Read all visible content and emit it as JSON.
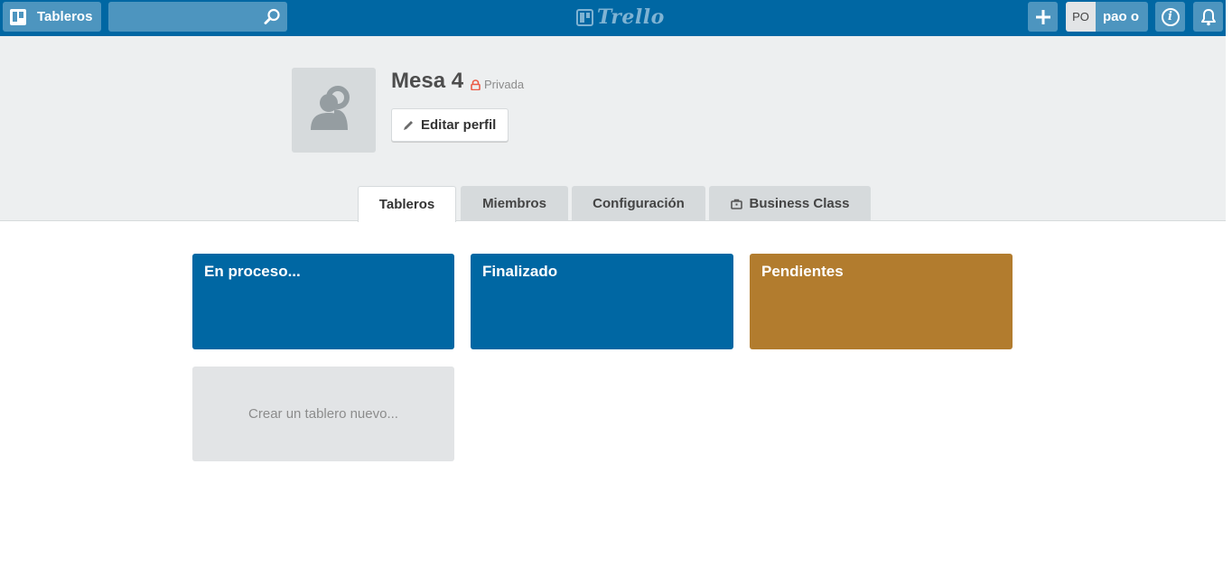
{
  "header": {
    "boards_button_label": "Tableros",
    "search": {
      "value": "",
      "placeholder": ""
    },
    "logo_text": "Trello",
    "add_icon": "plus-icon",
    "user": {
      "initials": "PO",
      "name": "pao o"
    },
    "info_icon": "info-icon",
    "notifications_icon": "bell-icon"
  },
  "profile": {
    "name": "Mesa 4",
    "privacy_label": "Privada",
    "edit_button_label": "Editar perfil"
  },
  "tabs": [
    {
      "label": "Tableros",
      "active": true
    },
    {
      "label": "Miembros",
      "active": false
    },
    {
      "label": "Configuración",
      "active": false
    },
    {
      "label": "Business Class",
      "active": false,
      "icon": "briefcase-icon"
    }
  ],
  "boards": [
    {
      "title": "En proceso...",
      "color": "#0067a3"
    },
    {
      "title": "Finalizado",
      "color": "#0067a3"
    },
    {
      "title": "Pendientes",
      "color": "#b27c2e"
    }
  ],
  "create_board_label": "Crear un tablero nuevo..."
}
